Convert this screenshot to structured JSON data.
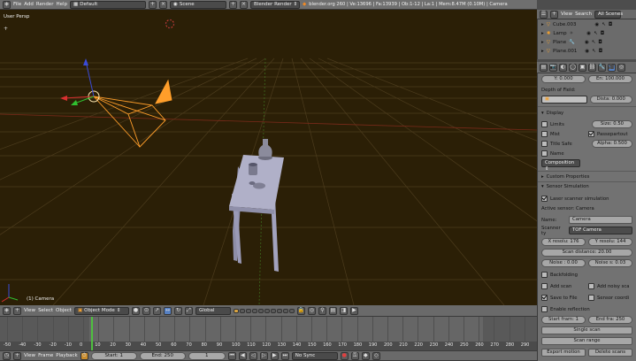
{
  "info_header": {
    "menus": [
      "File",
      "Add",
      "Render",
      "Help"
    ],
    "screen_layout": "Default",
    "scene": "Scene",
    "render_engine": "Blender Render",
    "stats": "blender.org 260 | Ve:13696 | Fa:13939 | Ob:1-12 | La:1 | Mem:8.47M (0.10M) | Camera"
  },
  "viewport": {
    "view_name": "User Persp",
    "object_label": "(1) Camera",
    "colors": {
      "background": "#2b1f06",
      "grid": "#4c3c1d",
      "camera": "#ff9e2a",
      "table": "#a9a9c2"
    }
  },
  "view3d_header": {
    "menus": [
      "View",
      "Select",
      "Object"
    ],
    "mode": "Object Mode",
    "orientation": "Global"
  },
  "outliner": {
    "menus": [
      "View",
      "Search"
    ],
    "filter": "All Scenes",
    "items": [
      "Cube.003",
      "Lamp",
      "Plane",
      "Plane.001"
    ]
  },
  "properties": {
    "field_y": "Y: 0.000",
    "field_end": "En: 100.000",
    "depth_of_field_label": "Depth of Field:",
    "distance": "Dista: 0.000",
    "display_panel": "Display",
    "limits": "Limits",
    "size": "Size: 0.50",
    "mist": "Mist",
    "passepartout": "Passepartout",
    "title_safe": "Title Safe",
    "alpha": "Alpha: 0.500",
    "name": "Name",
    "composition": "Composition",
    "custom_properties": "Custom Properties",
    "sensor_simulation": "Sensor Simulation",
    "laser_scanner": "Laser scanner simulation",
    "active_sensor": "Active sensor: Camera",
    "name_label": "Name:",
    "name_value": "Camera",
    "scanner_type_label": "Scanner ty",
    "scanner_type_value": "TOF Camera",
    "x_resolution": "X resolu: 176",
    "y_resolution": "Y resolu: 144",
    "scan_distance": "Scan distance: 20.00",
    "noise": "Noise : 0.00",
    "noise_sigma": "Noise s: 0.03",
    "backfolding": "Backfolding",
    "add_scan": "Add scan",
    "add_noisy_scan": "Add noisy sca",
    "save_to_file": "Save to File",
    "sensor_coordinates": "Sensor coordi",
    "enable_reflection": "Enable reflection",
    "start_frame": "Start fram: 1",
    "end_frame": "End fra: 250",
    "single_scan": "Single scan",
    "scan_range": "Scan range",
    "export_motion": "Export motion",
    "delete_scans": "Delete scans"
  },
  "timeline": {
    "ticks": [
      "-50",
      "-40",
      "-30",
      "-20",
      "-10",
      "0",
      "10",
      "20",
      "30",
      "40",
      "50",
      "60",
      "70",
      "80",
      "90",
      "100",
      "110",
      "120",
      "130",
      "140",
      "150",
      "160",
      "170",
      "180",
      "190",
      "200",
      "210",
      "220",
      "230",
      "240",
      "250",
      "260",
      "270",
      "280",
      "290"
    ],
    "current_frame_value": 1
  },
  "timeline_header": {
    "menus": [
      "View",
      "Frame",
      "Playback"
    ],
    "start": "Start: 1",
    "end": "End: 250",
    "current": "1",
    "sync": "No Sync"
  }
}
